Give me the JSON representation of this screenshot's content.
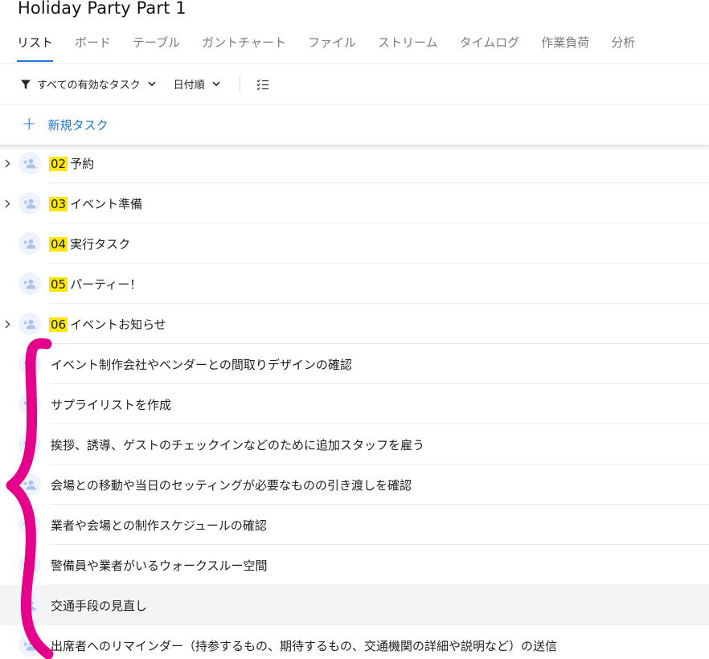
{
  "project": {
    "title": "Holiday Party Part 1"
  },
  "tabs": [
    {
      "label": "リスト",
      "active": true
    },
    {
      "label": "ボード",
      "active": false
    },
    {
      "label": "テーブル",
      "active": false
    },
    {
      "label": "ガントチャート",
      "active": false
    },
    {
      "label": "ファイル",
      "active": false
    },
    {
      "label": "ストリーム",
      "active": false
    },
    {
      "label": "タイムログ",
      "active": false
    },
    {
      "label": "作業負荷",
      "active": false
    },
    {
      "label": "分析",
      "active": false
    }
  ],
  "toolbar": {
    "filter_label": "すべての有効なタスク",
    "sort_label": "日付順",
    "filter_icon": "funnel-icon",
    "options_icon": "checklist-icon"
  },
  "new_task": {
    "label": "新規タスク",
    "plus": "+"
  },
  "sections": [
    {
      "number": "02",
      "name": "予約",
      "expandable": true
    },
    {
      "number": "03",
      "name": "イベント準備",
      "expandable": true
    },
    {
      "number": "04",
      "name": "実行タスク",
      "expandable": false
    },
    {
      "number": "05",
      "name": "パーティー！",
      "expandable": false
    },
    {
      "number": "06",
      "name": "イベントお知らせ",
      "expandable": true
    }
  ],
  "subtasks": [
    {
      "name": "イベント制作会社やベンダーとの間取りデザインの確認"
    },
    {
      "name": "サプライリストを作成"
    },
    {
      "name": "挨拶、誘導、ゲストのチェックインなどのために追加スタッフを雇う"
    },
    {
      "name": "会場との移動や当日のセッティングが必要なものの引き渡しを確認"
    },
    {
      "name": "業者や会場との制作スケジュールの確認"
    },
    {
      "name": "警備員や業者がいるウォークスルー空間"
    },
    {
      "name": "交通手段の見直し"
    },
    {
      "name": "出席者へのリマインダー（持参するもの、期待するもの、交通機関の詳細や説明など）の送信"
    }
  ],
  "colors": {
    "accent": "#1f76d2",
    "number_highlight": "#ffe800",
    "annotation": "#e5008c",
    "avatar_bg": "#eef3fb",
    "avatar_fg": "#a9c3ea"
  }
}
